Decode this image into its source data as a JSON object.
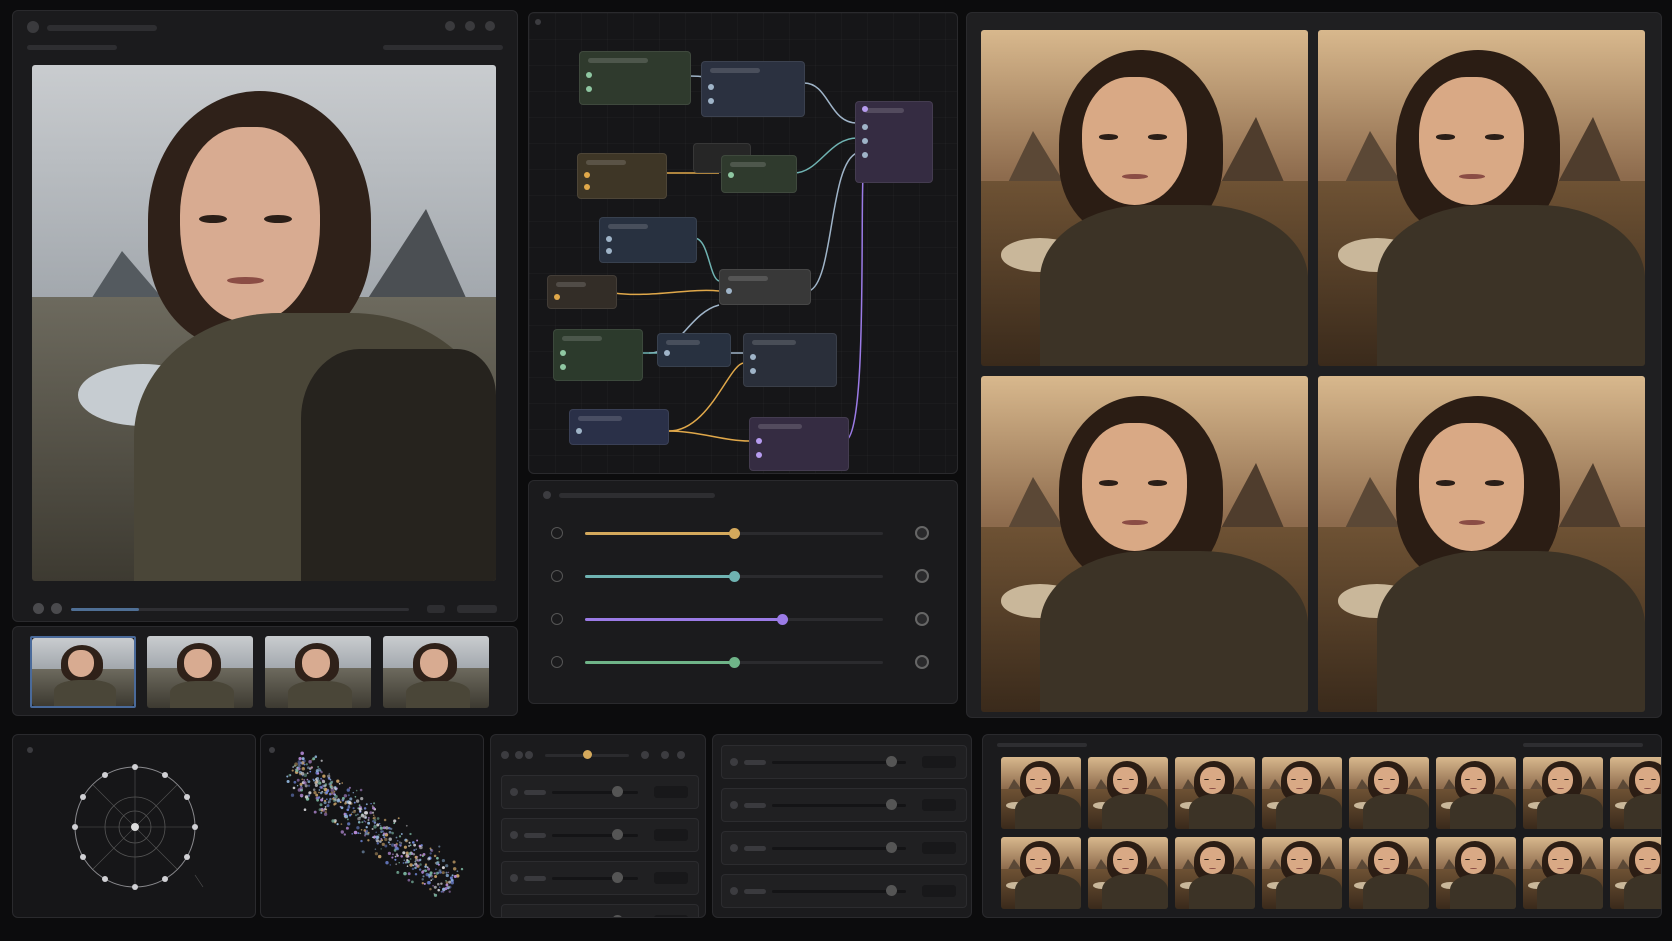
{
  "app": {
    "title": "",
    "accent_colors": {
      "gold": "#d4a95c",
      "teal": "#6fb3b2",
      "violet": "#9b7be6",
      "green": "#6fb488",
      "selected_thumb": "#4a6a9a"
    }
  },
  "preview": {
    "timeline_progress": 0.2
  },
  "sliders": [
    {
      "icon": "aperture-icon",
      "value": 0.5,
      "color": "#d4a95c"
    },
    {
      "icon": "circle-icon",
      "value": 0.5,
      "color": "#6fb3b2"
    },
    {
      "icon": "palette-icon",
      "value": 0.66,
      "color": "#9b7be6"
    },
    {
      "icon": "plus-circle-icon",
      "value": 0.5,
      "color": "#6fb488"
    }
  ],
  "thumb_strip": {
    "count": 4,
    "selected": 0
  },
  "variation_grid": {
    "rows": 2,
    "cols": 2
  },
  "bottom_gallery": {
    "rows": 2,
    "cols": 8
  },
  "mini_sliders_left": [
    0.7,
    0.7,
    0.7,
    0.7
  ],
  "mini_sliders_right": [
    0.85,
    0.85,
    0.85,
    0.85
  ]
}
